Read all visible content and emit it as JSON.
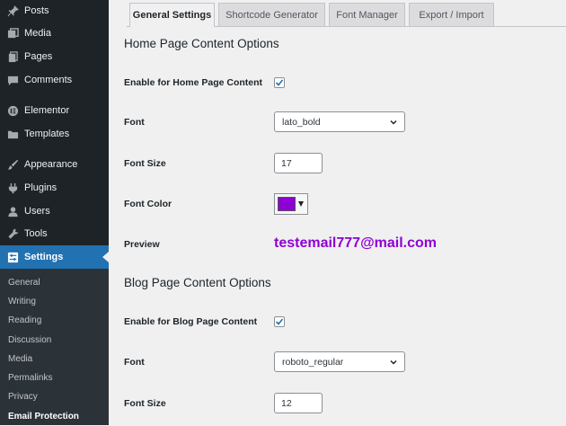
{
  "sidebar": {
    "items": [
      {
        "label": "Posts",
        "icon": "pin-icon"
      },
      {
        "label": "Media",
        "icon": "media-icon"
      },
      {
        "label": "Pages",
        "icon": "page-icon"
      },
      {
        "label": "Comments",
        "icon": "comment-icon"
      },
      {
        "label": "Elementor",
        "icon": "elementor-icon"
      },
      {
        "label": "Templates",
        "icon": "folder-icon"
      },
      {
        "label": "Appearance",
        "icon": "brush-icon"
      },
      {
        "label": "Plugins",
        "icon": "plug-icon"
      },
      {
        "label": "Users",
        "icon": "user-icon"
      },
      {
        "label": "Tools",
        "icon": "wrench-icon"
      },
      {
        "label": "Settings",
        "icon": "settings-icon",
        "active": true
      }
    ],
    "submenu": [
      {
        "label": "General"
      },
      {
        "label": "Writing"
      },
      {
        "label": "Reading"
      },
      {
        "label": "Discussion"
      },
      {
        "label": "Media"
      },
      {
        "label": "Permalinks"
      },
      {
        "label": "Privacy"
      },
      {
        "label": "Email Protection",
        "current": true
      }
    ]
  },
  "tabs": [
    {
      "label": "General Settings",
      "active": true
    },
    {
      "label": "Shortcode Generator"
    },
    {
      "label": "Font Manager"
    },
    {
      "label": "Export / Import"
    }
  ],
  "home": {
    "title": "Home Page Content Options",
    "enable_label": "Enable for Home Page Content",
    "enabled": true,
    "font_label": "Font",
    "font_value": "lato_bold",
    "size_label": "Font Size",
    "size_value": "17",
    "color_label": "Font Color",
    "color_value": "#8e00d4",
    "preview_label": "Preview",
    "preview_text": "testemail777@mail.com"
  },
  "blog": {
    "title": "Blog Page Content Options",
    "enable_label": "Enable for Blog Page Content",
    "enabled": true,
    "font_label": "Font",
    "font_value": "roboto_regular",
    "size_label": "Font Size",
    "size_value": "12"
  },
  "colors": {
    "sidebar_bg": "#1d2327",
    "submenu_bg": "#2c3338",
    "accent": "#2271b1",
    "preview": "#8e00d4",
    "checkmark": "#2271b1"
  }
}
